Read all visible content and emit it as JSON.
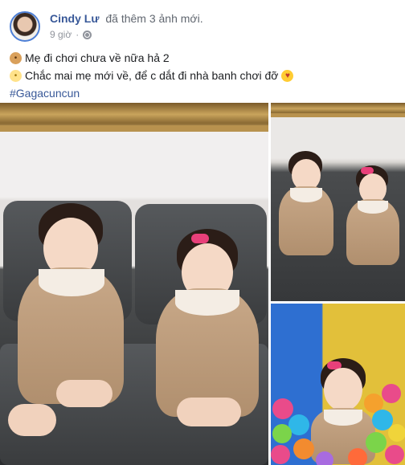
{
  "post": {
    "author": "Cindy Lư",
    "action": "đã thêm 3 ảnh mới.",
    "time": "9 giờ",
    "privacy_icon": "globe-icon"
  },
  "caption": {
    "line1_icon": "hamster-emoji",
    "line1": "Mẹ đi chơi chưa về nữa hả 2",
    "line2_icon": "chick-emoji",
    "line2": "Chắc mai mẹ mới về, để c dắt đi nhà banh chơi đỡ",
    "line2_end_icon": "kiss-emoji",
    "hashtag": "#Gagacuncun"
  },
  "photos": [
    {
      "name": "photo-two-girls-on-sofa"
    },
    {
      "name": "photo-two-girls-sofa-second"
    },
    {
      "name": "photo-girl-ball-pit"
    }
  ],
  "colors": {
    "link": "#385898",
    "meta": "#90949c",
    "text": "#1c1e21"
  }
}
